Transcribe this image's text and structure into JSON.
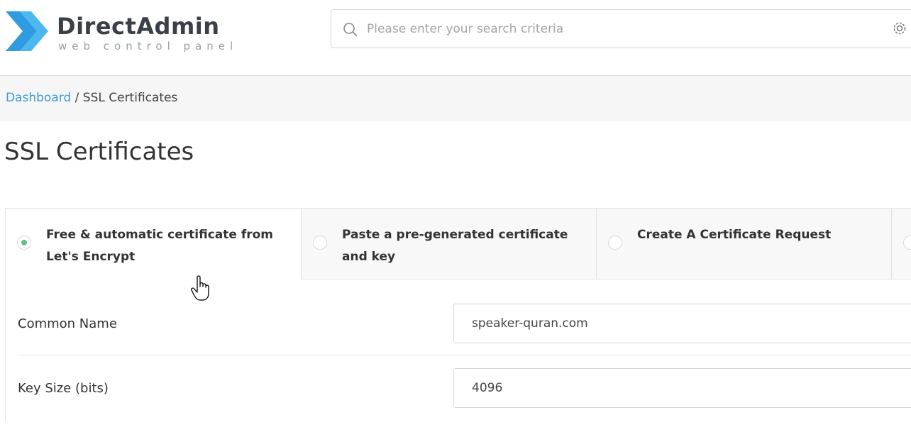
{
  "header": {
    "logo_title": "DirectAdmin",
    "logo_subtitle": "web control panel",
    "search_placeholder": "Please enter your search criteria",
    "brand_colors": {
      "logo_blue": "#2f9be0",
      "logo_light": "#4db8ef"
    }
  },
  "breadcrumb": {
    "link": "Dashboard",
    "separator": " / ",
    "current": "SSL Certificates"
  },
  "page": {
    "title": "SSL Certificates"
  },
  "tabs": [
    {
      "label": "Free & automatic certificate from Let's Encrypt",
      "selected": true
    },
    {
      "label": "Paste a pre-generated certificate and key",
      "selected": false
    },
    {
      "label": "Create A Certificate Request",
      "selected": false
    }
  ],
  "form": {
    "common_name": {
      "label": "Common Name",
      "value": "speaker-quran.com"
    },
    "key_size": {
      "label": "Key Size (bits)",
      "value": "4096"
    }
  },
  "icons": {
    "search": "magnifier-icon",
    "settings": "gear-icon",
    "cursor": "hand-pointer-icon"
  },
  "colors": {
    "accent_green": "#5cc08f",
    "link_blue": "#3a9bd6"
  }
}
